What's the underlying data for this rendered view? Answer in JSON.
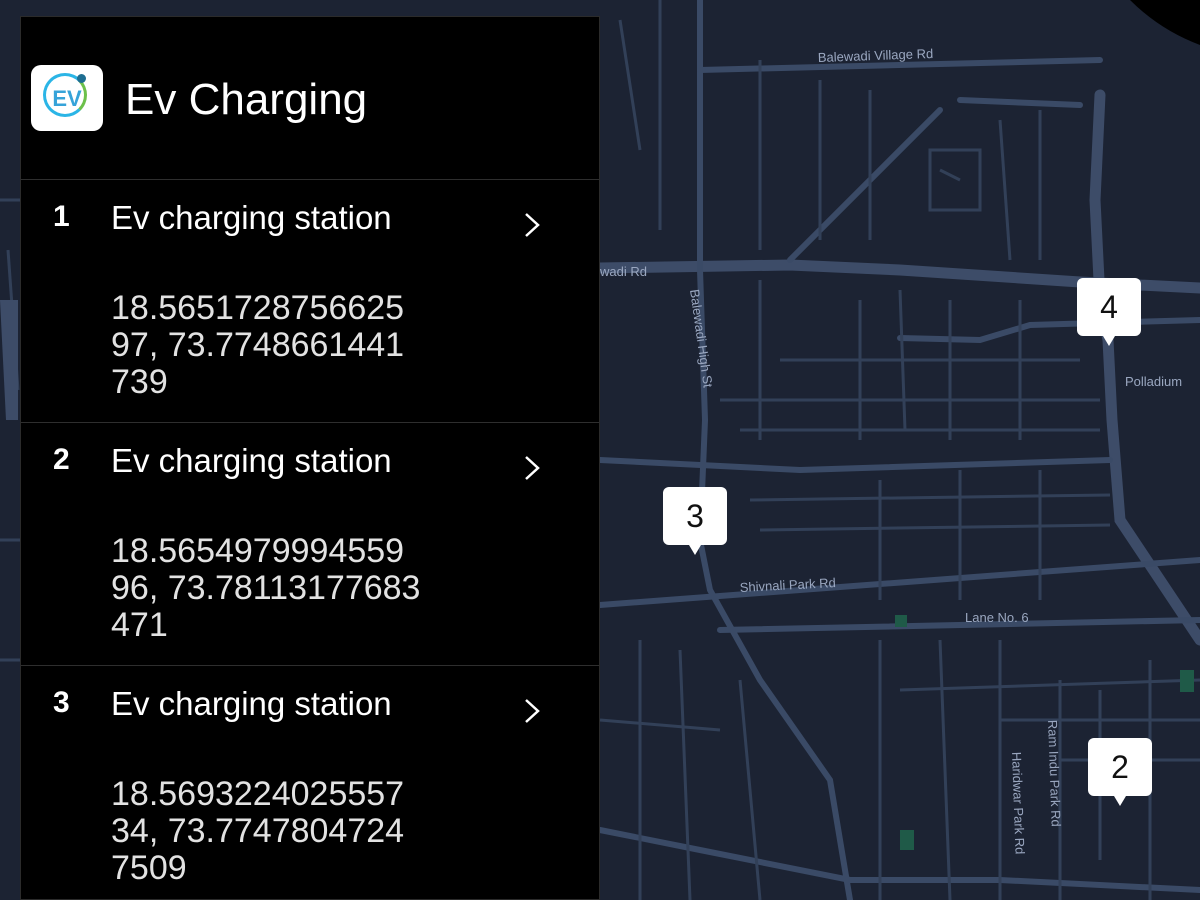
{
  "app": {
    "title": "Ev Charging",
    "icon": "ev-logo-icon",
    "icon_text": "EV"
  },
  "stations": [
    {
      "number": "1",
      "name": "Ev charging station",
      "coords": "18.565172875662597, 73.7748661441739"
    },
    {
      "number": "2",
      "name": "Ev charging station",
      "coords": "18.565497999455996, 73.78113177683471"
    },
    {
      "number": "3",
      "name": "Ev charging station",
      "coords": "18.569322402555734, 73.77478047247509"
    }
  ],
  "map": {
    "background_color": "#1c2333",
    "road_color": "#3a4a66",
    "labels": [
      "Balewadi Village Rd",
      "wadi Rd",
      "Balewadi High St",
      "Shivnali Park Rd",
      "Lane No. 6",
      "Polladium",
      "Ram Indu Park Rd",
      "Haridwar Park Rd"
    ],
    "markers": [
      "4",
      "3",
      "2"
    ]
  },
  "colors": {
    "panel_bg": "#000000",
    "text_primary": "#ffffff",
    "text_secondary": "#e2e2e2",
    "divider": "#2e2e2e"
  }
}
